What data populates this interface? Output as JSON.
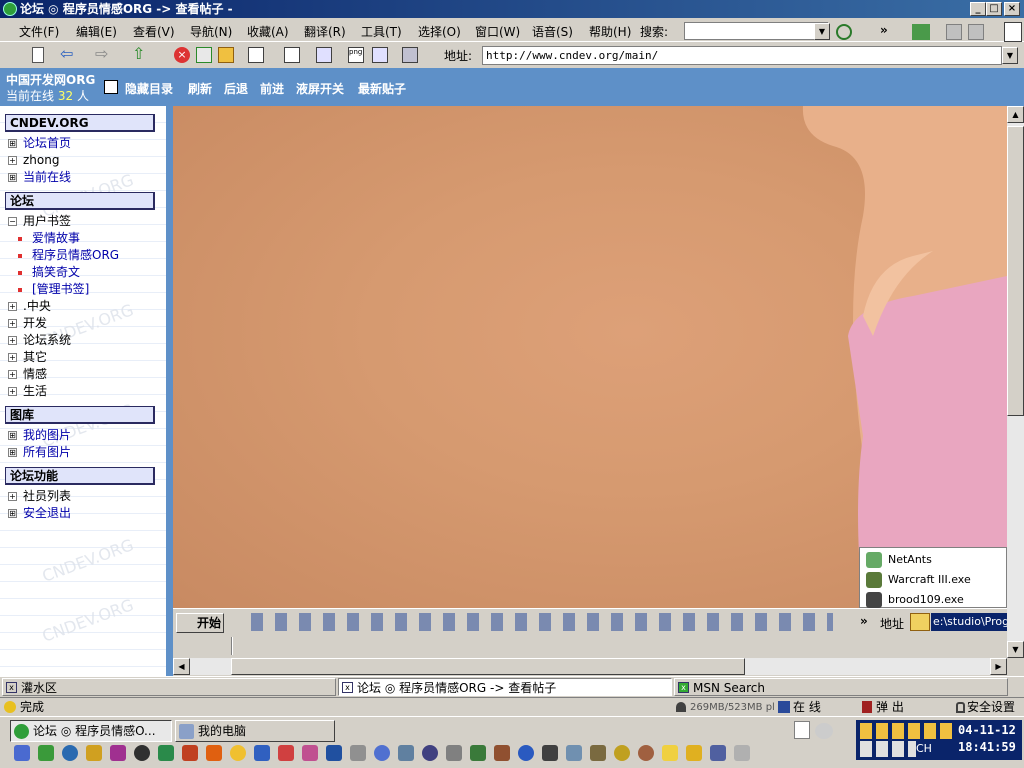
{
  "window": {
    "title": "论坛 ◎ 程序员情感ORG -> 查看帖子 -"
  },
  "menu": {
    "items": [
      "文件(F)",
      "编辑(E)",
      "查看(V)",
      "导航(N)",
      "收藏(A)",
      "翻译(R)",
      "工具(T)",
      "选择(O)",
      "窗口(W)",
      "语音(S)",
      "帮助(H)"
    ],
    "search_label": "搜索:",
    "more": "»"
  },
  "toolbar": {
    "address_label": "地址:",
    "address_value": "http://www.cndev.org/main/"
  },
  "header": {
    "site_name": "中国开发网ORG",
    "online_prefix": "当前在线",
    "online_count": "32",
    "online_suffix": "人",
    "nav": [
      "隐藏目录",
      "刷新",
      "后退",
      "前进",
      "液屏开关",
      "最新贴子"
    ]
  },
  "sidebar": {
    "sections": [
      {
        "title": "CNDEV.ORG",
        "items": [
          {
            "box": "⊞",
            "label": "论坛首页",
            "link": true
          },
          {
            "box": "+",
            "label": "zhong",
            "link": false
          },
          {
            "box": "⊞",
            "label": "当前在线",
            "link": true
          }
        ]
      },
      {
        "title": "论坛",
        "items": [
          {
            "box": "−",
            "label": "用户书签",
            "link": false
          }
        ]
      },
      {
        "title": "图库",
        "items": [
          {
            "box": "⊞",
            "label": "我的图片",
            "link": true
          },
          {
            "box": "⊞",
            "label": "所有图片",
            "link": true
          }
        ]
      },
      {
        "title": "论坛功能",
        "items": [
          {
            "box": "+",
            "label": "社员列表",
            "link": false
          },
          {
            "box": "⊞",
            "label": "安全退出",
            "link": true
          }
        ]
      }
    ],
    "bookmarks": [
      "爱情故事",
      "程序员情感ORG",
      "搞笑奇文",
      "[管理书签]"
    ],
    "groups": [
      ".中央",
      "开发",
      "论坛系统",
      "其它",
      "情感",
      "生活"
    ],
    "watermark": "CNDEV.ORG"
  },
  "inner_taskbar": {
    "start": "开始",
    "address_label": "地址",
    "address_value": "e:\\studio\\Progra",
    "more": "»"
  },
  "popup": {
    "items": [
      "NetAnts",
      "Warcraft III.exe",
      "brood109.exe"
    ]
  },
  "tabs": [
    "灌水区",
    "论坛 ◎ 程序员情感ORG -> 查看帖子",
    "MSN Search"
  ],
  "status": {
    "done": "完成",
    "memory": "269MB/523MB pl",
    "online": "在 线",
    "popup": "弹 出",
    "security": "安全设置"
  },
  "taskbar": {
    "tasks": [
      "论坛 ◎ 程序员情感O...",
      "我的电脑"
    ],
    "tray_date": "04-11-12",
    "tray_time": "18:41:59",
    "lang": "CH"
  },
  "colors": {
    "header_blue": "#5e90c8",
    "title_dark": "#0a246a",
    "link": "#0000aa",
    "skin": "#d69a70"
  }
}
